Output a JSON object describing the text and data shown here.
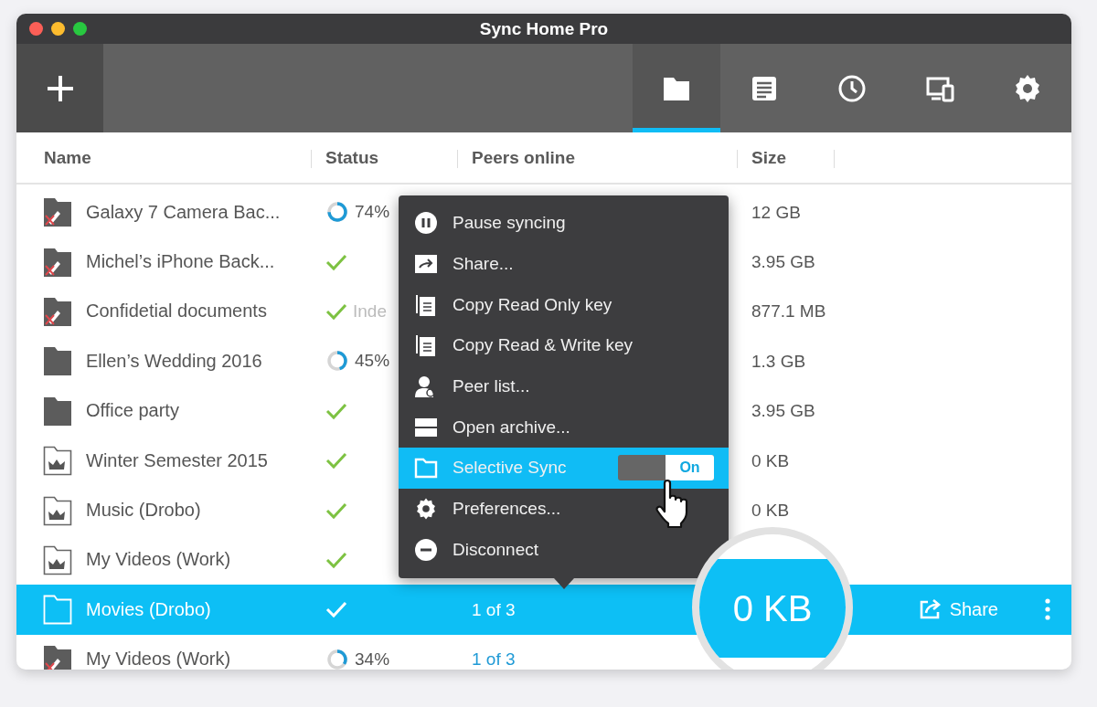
{
  "window": {
    "title": "Sync Home Pro"
  },
  "toolbar": {
    "tabs": [
      {
        "kind": "folders",
        "selected": true
      },
      {
        "kind": "log",
        "selected": false
      },
      {
        "kind": "history",
        "selected": false
      },
      {
        "kind": "devices",
        "selected": false
      },
      {
        "kind": "settings",
        "selected": false
      }
    ]
  },
  "columns": [
    "Name",
    "Status",
    "Peers online",
    "Size"
  ],
  "rows": [
    {
      "kind": "restricted",
      "name": "Galaxy 7 Camera Bac...",
      "status": {
        "kind": "progress",
        "level": 0.74,
        "text": "74%"
      },
      "size": "12 GB",
      "selected": false
    },
    {
      "kind": "restricted",
      "name": "Michel’s iPhone Back...",
      "status": {
        "kind": "done"
      },
      "size": "3.95 GB",
      "selected": false
    },
    {
      "kind": "restricted",
      "name": "Confidetial documents",
      "status": {
        "kind": "done",
        "note": "Inde"
      },
      "size": "877.1 MB",
      "selected": false
    },
    {
      "kind": "full",
      "name": "Ellen’s Wedding 2016",
      "status": {
        "kind": "progress",
        "level": 0.45,
        "text": "45%"
      },
      "size": "1.3 GB",
      "selected": false
    },
    {
      "kind": "full",
      "name": "Office party",
      "status": {
        "kind": "done"
      },
      "size": "3.95 GB",
      "selected": false
    },
    {
      "kind": "crown",
      "name": "Winter Semester 2015",
      "status": {
        "kind": "done"
      },
      "size": "0 KB",
      "selected": false
    },
    {
      "kind": "crown",
      "name": "Music (Drobo)",
      "status": {
        "kind": "done"
      },
      "size": "0 KB",
      "selected": false
    },
    {
      "kind": "crown",
      "name": "My Videos (Work)",
      "status": {
        "kind": "done"
      },
      "selected": false
    },
    {
      "kind": "empty",
      "name": "Movies (Drobo)",
      "status": {
        "kind": "done"
      },
      "peers": "1 of 3",
      "selected": true,
      "share": "Share"
    },
    {
      "kind": "restricted",
      "name": "My Videos (Work)",
      "status": {
        "kind": "progress",
        "level": 0.34,
        "text": "34%"
      },
      "peers": "1 of 3",
      "selected": false
    }
  ],
  "menu": [
    {
      "kind": "pause",
      "label": "Pause syncing",
      "selected": false
    },
    {
      "kind": "share",
      "label": "Share...",
      "selected": false
    },
    {
      "kind": "copy",
      "label": "Copy Read Only key",
      "selected": false
    },
    {
      "kind": "copy",
      "label": "Copy Read & Write key",
      "selected": false
    },
    {
      "kind": "peers",
      "label": "Peer list...",
      "selected": false
    },
    {
      "kind": "archive",
      "label": "Open archive...",
      "selected": false
    },
    {
      "kind": "folder",
      "label": "Selective Sync",
      "selected": true,
      "toggle": {
        "on": true,
        "text": "On"
      }
    },
    {
      "kind": "settings",
      "label": "Preferences...",
      "selected": false
    },
    {
      "kind": "disconnect",
      "label": "Disconnect",
      "selected": false
    }
  ],
  "magnifier": {
    "text": "0 KB"
  }
}
